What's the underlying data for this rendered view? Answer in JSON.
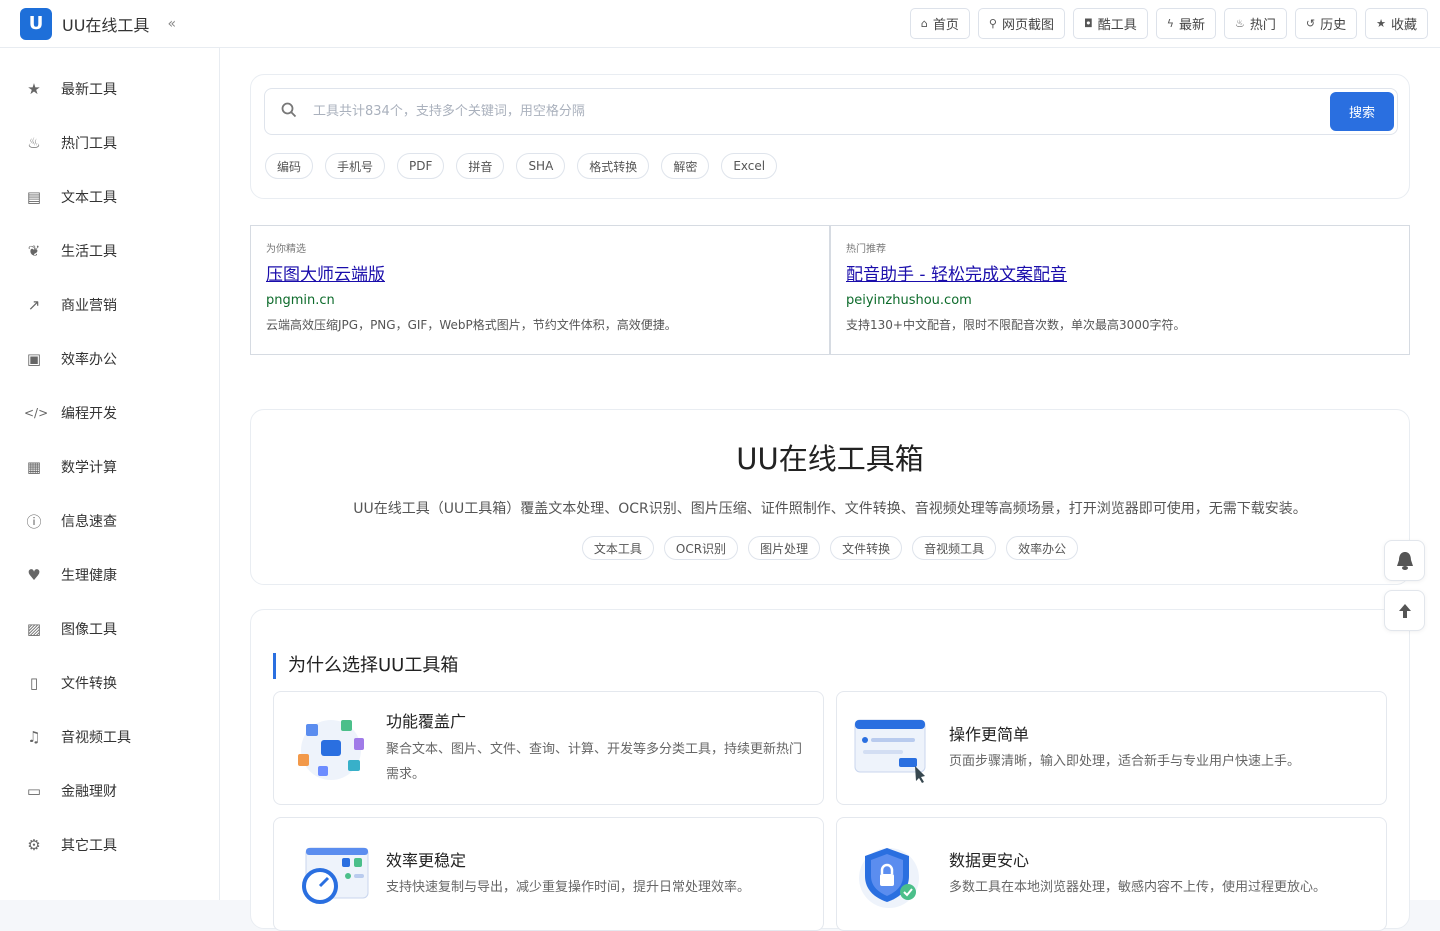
{
  "app": {
    "name": "UU在线工具",
    "collapse": "«",
    "logo_letter": "U"
  },
  "topnav": [
    {
      "icon": "home-icon",
      "glyph": "⌂",
      "label": "首页"
    },
    {
      "icon": "link-icon",
      "glyph": "⚲",
      "label": "网页截图"
    },
    {
      "icon": "camera-icon",
      "glyph": "◘",
      "label": "酷工具"
    },
    {
      "icon": "bolt-icon",
      "glyph": "ϟ",
      "label": "最新"
    },
    {
      "icon": "fire-icon",
      "glyph": "♨",
      "label": "热门"
    },
    {
      "icon": "history-icon",
      "glyph": "↺",
      "label": "历史"
    },
    {
      "icon": "star-icon",
      "glyph": "★",
      "label": "收藏"
    }
  ],
  "sidebar": [
    {
      "icon": "star-icon",
      "glyph": "★",
      "label": "最新工具"
    },
    {
      "icon": "fire-icon",
      "glyph": "♨",
      "label": "热门工具"
    },
    {
      "icon": "file-text-icon",
      "glyph": "▤",
      "label": "文本工具"
    },
    {
      "icon": "leaf-icon",
      "glyph": "❦",
      "label": "生活工具"
    },
    {
      "icon": "chart-line-icon",
      "glyph": "↗",
      "label": "商业营销"
    },
    {
      "icon": "briefcase-icon",
      "glyph": "▣",
      "label": "效率办公"
    },
    {
      "icon": "code-icon",
      "glyph": "</>",
      "label": "编程开发"
    },
    {
      "icon": "calculator-icon",
      "glyph": "▦",
      "label": "数学计算"
    },
    {
      "icon": "info-icon",
      "glyph": "ⓘ",
      "label": "信息速查"
    },
    {
      "icon": "heartbeat-icon",
      "glyph": "♥",
      "label": "生理健康"
    },
    {
      "icon": "image-icon",
      "glyph": "▨",
      "label": "图像工具"
    },
    {
      "icon": "file-convert-icon",
      "glyph": "▯",
      "label": "文件转换"
    },
    {
      "icon": "music-icon",
      "glyph": "♫",
      "label": "音视频工具"
    },
    {
      "icon": "money-icon",
      "glyph": "▭",
      "label": "金融理财"
    },
    {
      "icon": "gear-icon",
      "glyph": "⚙",
      "label": "其它工具"
    }
  ],
  "search": {
    "placeholder": "工具共计834个，支持多个关键词，用空格分隔",
    "button": "搜索",
    "tags": [
      "编码",
      "手机号",
      "PDF",
      "拼音",
      "SHA",
      "格式转换",
      "解密",
      "Excel"
    ]
  },
  "ads": [
    {
      "label": "为你精选",
      "title": "压图大师云端版",
      "url": "pngmin.cn",
      "desc": "云端高效压缩JPG，PNG，GIF，WebP格式图片，节约文件体积，高效便捷。"
    },
    {
      "label": "热门推荐",
      "title": "配音助手 - 轻松完成文案配音",
      "url": "peiyinzhushou.com",
      "desc": "支持130+中文配音，限时不限配音次数，单次最高3000字符。"
    }
  ],
  "hero": {
    "title": "UU在线工具箱",
    "desc": "UU在线工具（UU工具箱）覆盖文本处理、OCR识别、图片压缩、证件照制作、文件转换、音视频处理等高频场景，打开浏览器即可使用，无需下载安装。",
    "tags": [
      "文本工具",
      "OCR识别",
      "图片处理",
      "文件转换",
      "音视频工具",
      "效率办公"
    ]
  },
  "why": {
    "title": "为什么选择UU工具箱",
    "features": [
      {
        "title": "功能覆盖广",
        "desc": "聚合文本、图片、文件、查询、计算、开发等多分类工具，持续更新热门需求。"
      },
      {
        "title": "操作更简单",
        "desc": "页面步骤清晰，输入即处理，适合新手与专业用户快速上手。"
      },
      {
        "title": "效率更稳定",
        "desc": "支持快速复制与导出，减少重复操作时间，提升日常处理效率。"
      },
      {
        "title": "数据更安心",
        "desc": "多数工具在本地浏览器处理，敏感内容不上传，使用过程更放心。"
      }
    ]
  },
  "colors": {
    "accent": "#2a6fe0",
    "ad_title": "#1a0dab",
    "ad_url": "#0d6b2b"
  }
}
